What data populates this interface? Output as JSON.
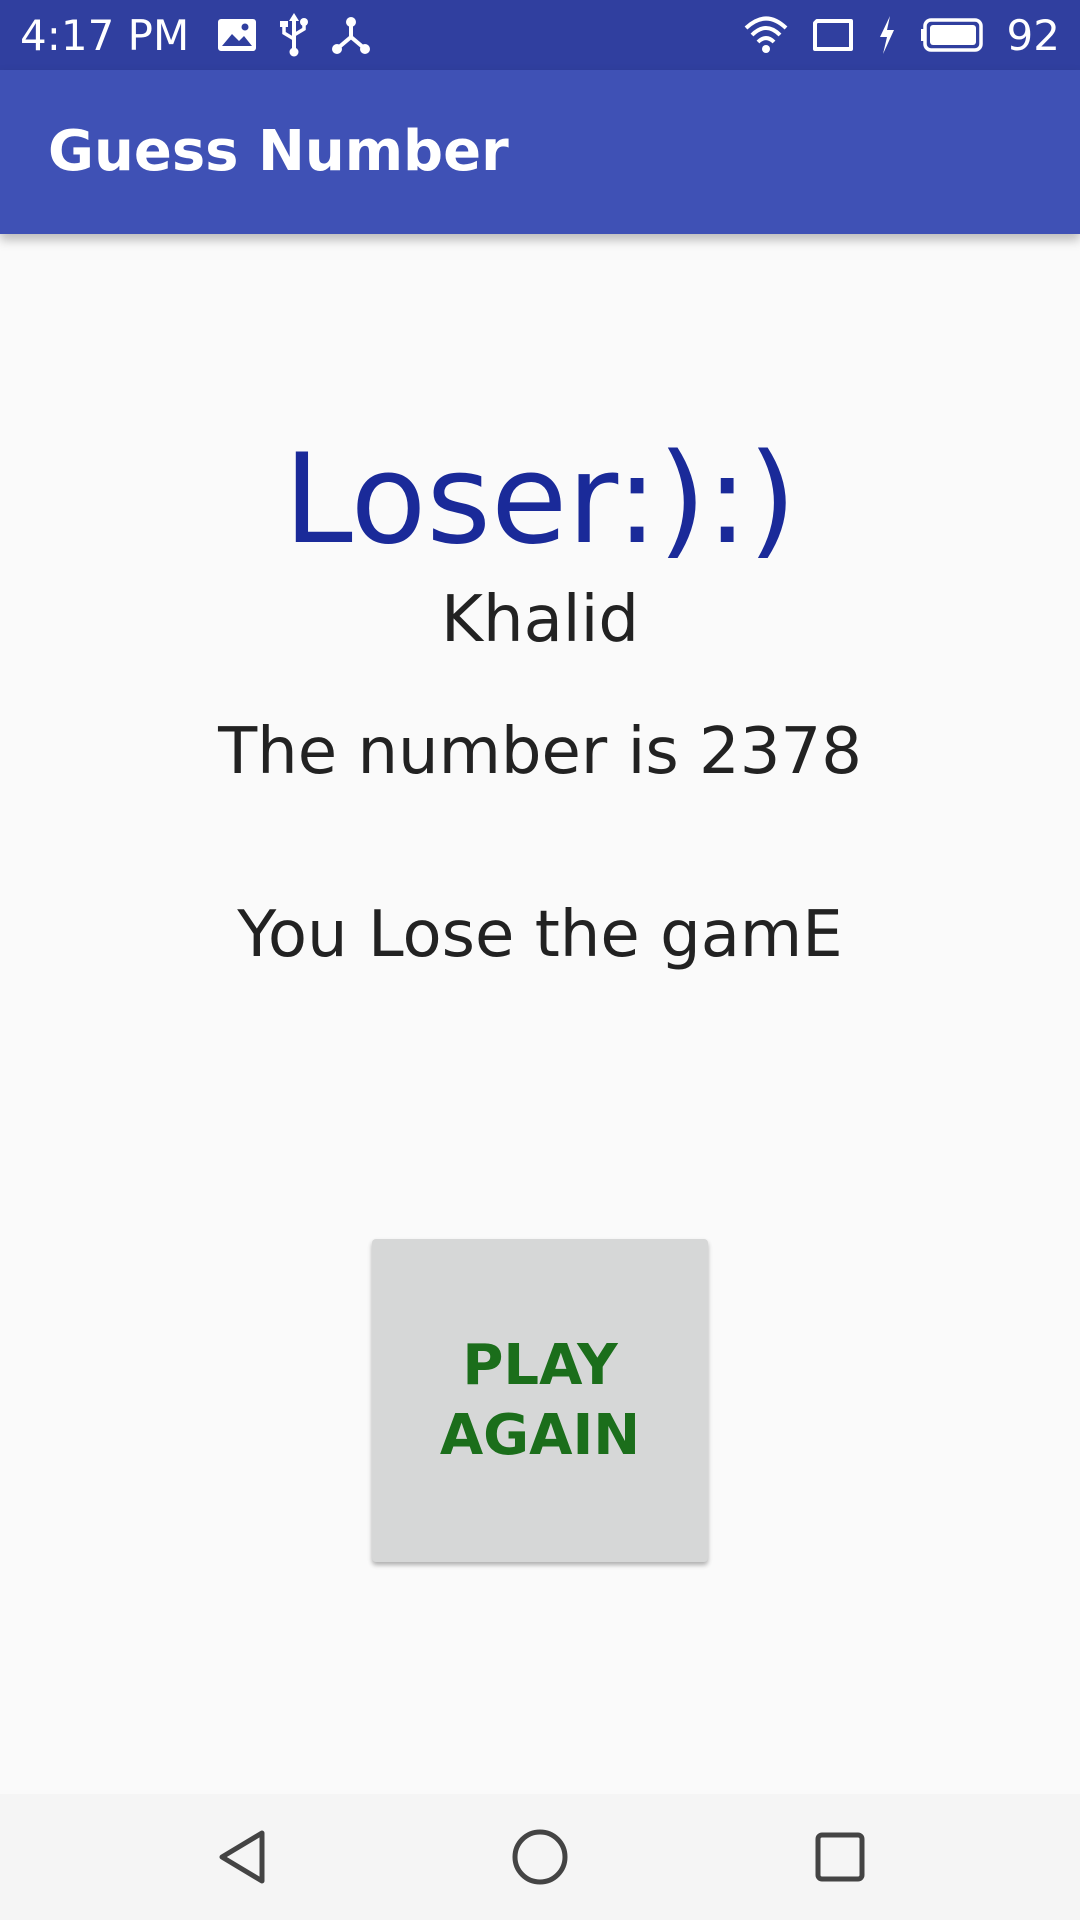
{
  "status_bar": {
    "time": "4:17 PM",
    "battery_level": "92",
    "background_color": "#303f9f",
    "left_icons": [
      "image-notification-icon",
      "usb-icon",
      "share-icon"
    ],
    "right_icons": [
      "wifi-icon",
      "screen-cast-icon",
      "charging-icon",
      "battery-icon"
    ]
  },
  "app_bar": {
    "title": "Guess Number",
    "background_color": "#3f51b5"
  },
  "main": {
    "result_title": "Loser:):)",
    "player_name": "Khalid",
    "number_text": "The number is 2378",
    "result_text": "You Lose the gamE",
    "play_again_label": "PLAY AGAIN",
    "title_color": "#1a2a99",
    "button_text_color": "#1b6e1b"
  },
  "nav_bar": {
    "buttons": [
      "back-icon",
      "home-icon",
      "recents-icon"
    ]
  }
}
